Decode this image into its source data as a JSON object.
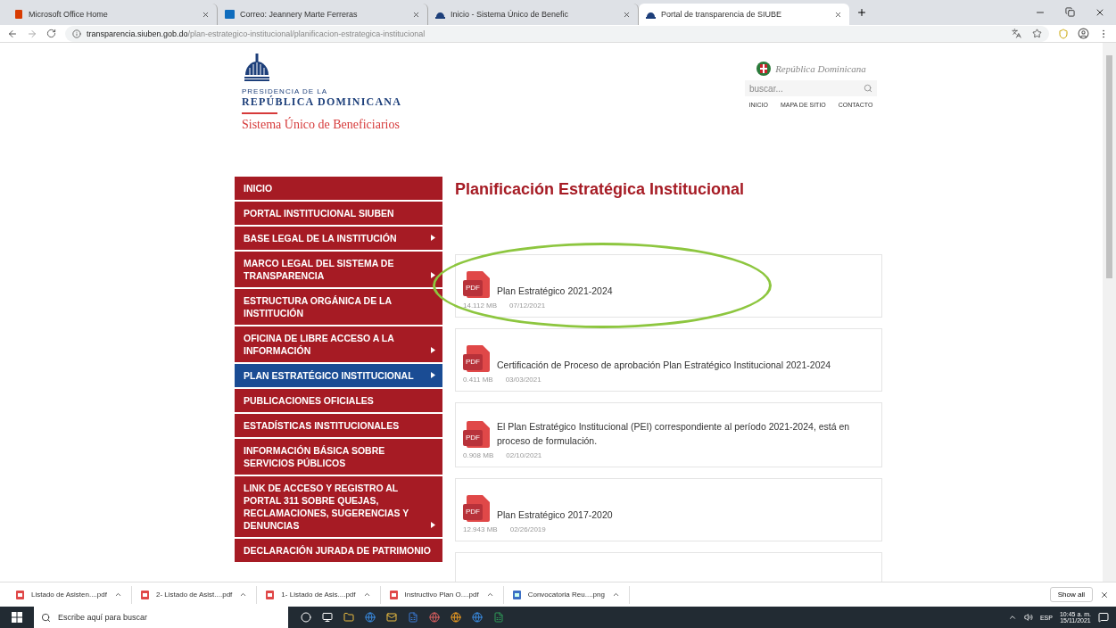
{
  "browser": {
    "tabs": [
      {
        "title": "Microsoft Office Home",
        "kind": "office",
        "selected": false
      },
      {
        "title": "Correo: Jeannery Marte Ferreras",
        "kind": "mail",
        "selected": false
      },
      {
        "title": "Inicio - Sistema Único de Benefic",
        "kind": "dome",
        "selected": false
      },
      {
        "title": "Portal de transparencia de SIUBE",
        "kind": "dome",
        "selected": true
      }
    ],
    "url": {
      "domain": "transparencia.siuben.gob.do",
      "path": "/plan-estrategico-institucional/planificacion-estrategica-institucional"
    }
  },
  "header": {
    "logo": {
      "line_1": "PRESIDENCIA DE LA",
      "line_2": "REPÚBLICA DOMINICANA",
      "subtitle": "Sistema Único de Beneficiarios"
    },
    "country": "República Dominicana",
    "search": {
      "placeholder": "buscar..."
    },
    "nav": [
      "INICIO",
      "MAPA DE SITIO",
      "CONTACTO"
    ]
  },
  "sidebar": {
    "items": [
      {
        "label": "INICIO",
        "submenu": false,
        "selected": false
      },
      {
        "label": "PORTAL INSTITUCIONAL SIUBEN",
        "submenu": false,
        "selected": false
      },
      {
        "label": "BASE LEGAL DE LA INSTITUCIÓN",
        "submenu": true,
        "selected": false
      },
      {
        "label": "MARCO LEGAL DEL SISTEMA DE TRANSPARENCIA",
        "submenu": true,
        "selected": false
      },
      {
        "label": "ESTRUCTURA ORGÁNICA DE LA INSTITUCIÓN",
        "submenu": false,
        "selected": false
      },
      {
        "label": "OFICINA DE LIBRE ACCESO A LA INFORMACIÓN",
        "submenu": true,
        "selected": false
      },
      {
        "label": "PLAN ESTRATÉGICO INSTITUCIONAL",
        "submenu": true,
        "selected": true
      },
      {
        "label": "PUBLICACIONES OFICIALES",
        "submenu": false,
        "selected": false
      },
      {
        "label": "ESTADÍSTICAS INSTITUCIONALES",
        "submenu": false,
        "selected": false
      },
      {
        "label": "INFORMACIÓN BÁSICA SOBRE SERVICIOS PÚBLICOS",
        "submenu": false,
        "selected": false
      },
      {
        "label": "LINK DE ACCESO Y REGISTRO AL PORTAL 311 SOBRE QUEJAS, RECLAMACIONES, SUGERENCIAS Y DENUNCIAS",
        "submenu": true,
        "selected": false
      },
      {
        "label": "DECLARACIÓN JURADA DE PATRIMONIO",
        "submenu": false,
        "selected": false
      }
    ]
  },
  "content": {
    "title": "Planificación Estratégica Institucional",
    "documents": [
      {
        "badge": "PDF",
        "title": "Plan Estratégico 2021-2024",
        "size": "14.112 MB",
        "date": "07/12/2021",
        "circled": true
      },
      {
        "badge": "PDF",
        "title": "Certificación de Proceso de aprobación Plan Estratégico Institucional 2021-2024",
        "size": "0.411 MB",
        "date": "03/03/2021",
        "circled": false
      },
      {
        "badge": "PDF",
        "title": "El Plan Estratégico Institucional (PEI) correspondiente al período 2021-2024, está en proceso de formulación.",
        "size": "0.908 MB",
        "date": "02/10/2021",
        "circled": false
      },
      {
        "badge": "PDF",
        "title": "Plan Estratégico 2017-2020",
        "size": "12.943 MB",
        "date": "02/26/2019",
        "circled": false
      }
    ]
  },
  "downloads": {
    "items": [
      {
        "name": "Listado de Asisten....pdf",
        "kind": "pdf"
      },
      {
        "name": "2- Listado de Asist....pdf",
        "kind": "pdf"
      },
      {
        "name": "1- Listado de Asis....pdf",
        "kind": "pdf"
      },
      {
        "name": "Instructivo Plan O....pdf",
        "kind": "pdf"
      },
      {
        "name": "Convocatoria Reu....png",
        "kind": "image"
      }
    ],
    "show_all": "Show all"
  },
  "taskbar": {
    "search": {
      "placeholder": "Escribe aquí para buscar"
    },
    "language": "ESP",
    "time": "10:45 a. m.",
    "date": "15/11/2021"
  }
}
